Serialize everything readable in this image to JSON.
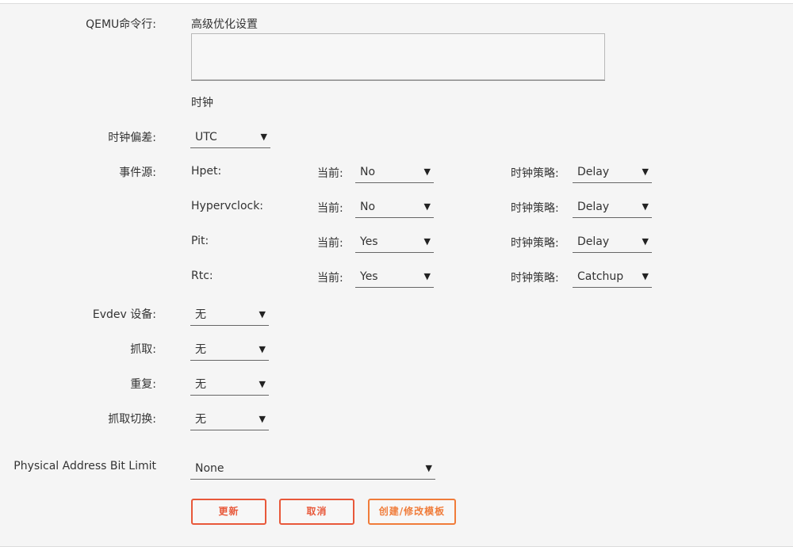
{
  "labels": {
    "qemu_cmd": "QEMU命令行:",
    "clock_offset": "时钟偏差:",
    "event_source": "事件源:",
    "evdev": "Evdev 设备:",
    "grab": "抓取:",
    "repeat": "重复:",
    "grab_toggle": "抓取切换:",
    "phys_addr": "Physical Address Bit Limit"
  },
  "sections": {
    "advanced": "高级优化设置",
    "clock": "时钟"
  },
  "clock_offset_value": "UTC",
  "timers": [
    {
      "name": "Hpet:",
      "present_label": "当前:",
      "present": "No",
      "policy_label": "时钟策略:",
      "policy": "Delay"
    },
    {
      "name": "Hypervclock:",
      "present_label": "当前:",
      "present": "No",
      "policy_label": "时钟策略:",
      "policy": "Delay"
    },
    {
      "name": "Pit:",
      "present_label": "当前:",
      "present": "Yes",
      "policy_label": "时钟策略:",
      "policy": "Delay"
    },
    {
      "name": "Rtc:",
      "present_label": "当前:",
      "present": "Yes",
      "policy_label": "时钟策略:",
      "policy": "Catchup"
    }
  ],
  "evdev_value": "无",
  "grab_value": "无",
  "repeat_value": "无",
  "grab_toggle_value": "无",
  "phys_addr_value": "None",
  "arrow": "▼",
  "buttons": {
    "update": "更新",
    "cancel": "取消",
    "template": "创建/修改模板"
  },
  "colors": {
    "accent_red": "#e8583a",
    "accent_orange": "#f07c3a"
  }
}
